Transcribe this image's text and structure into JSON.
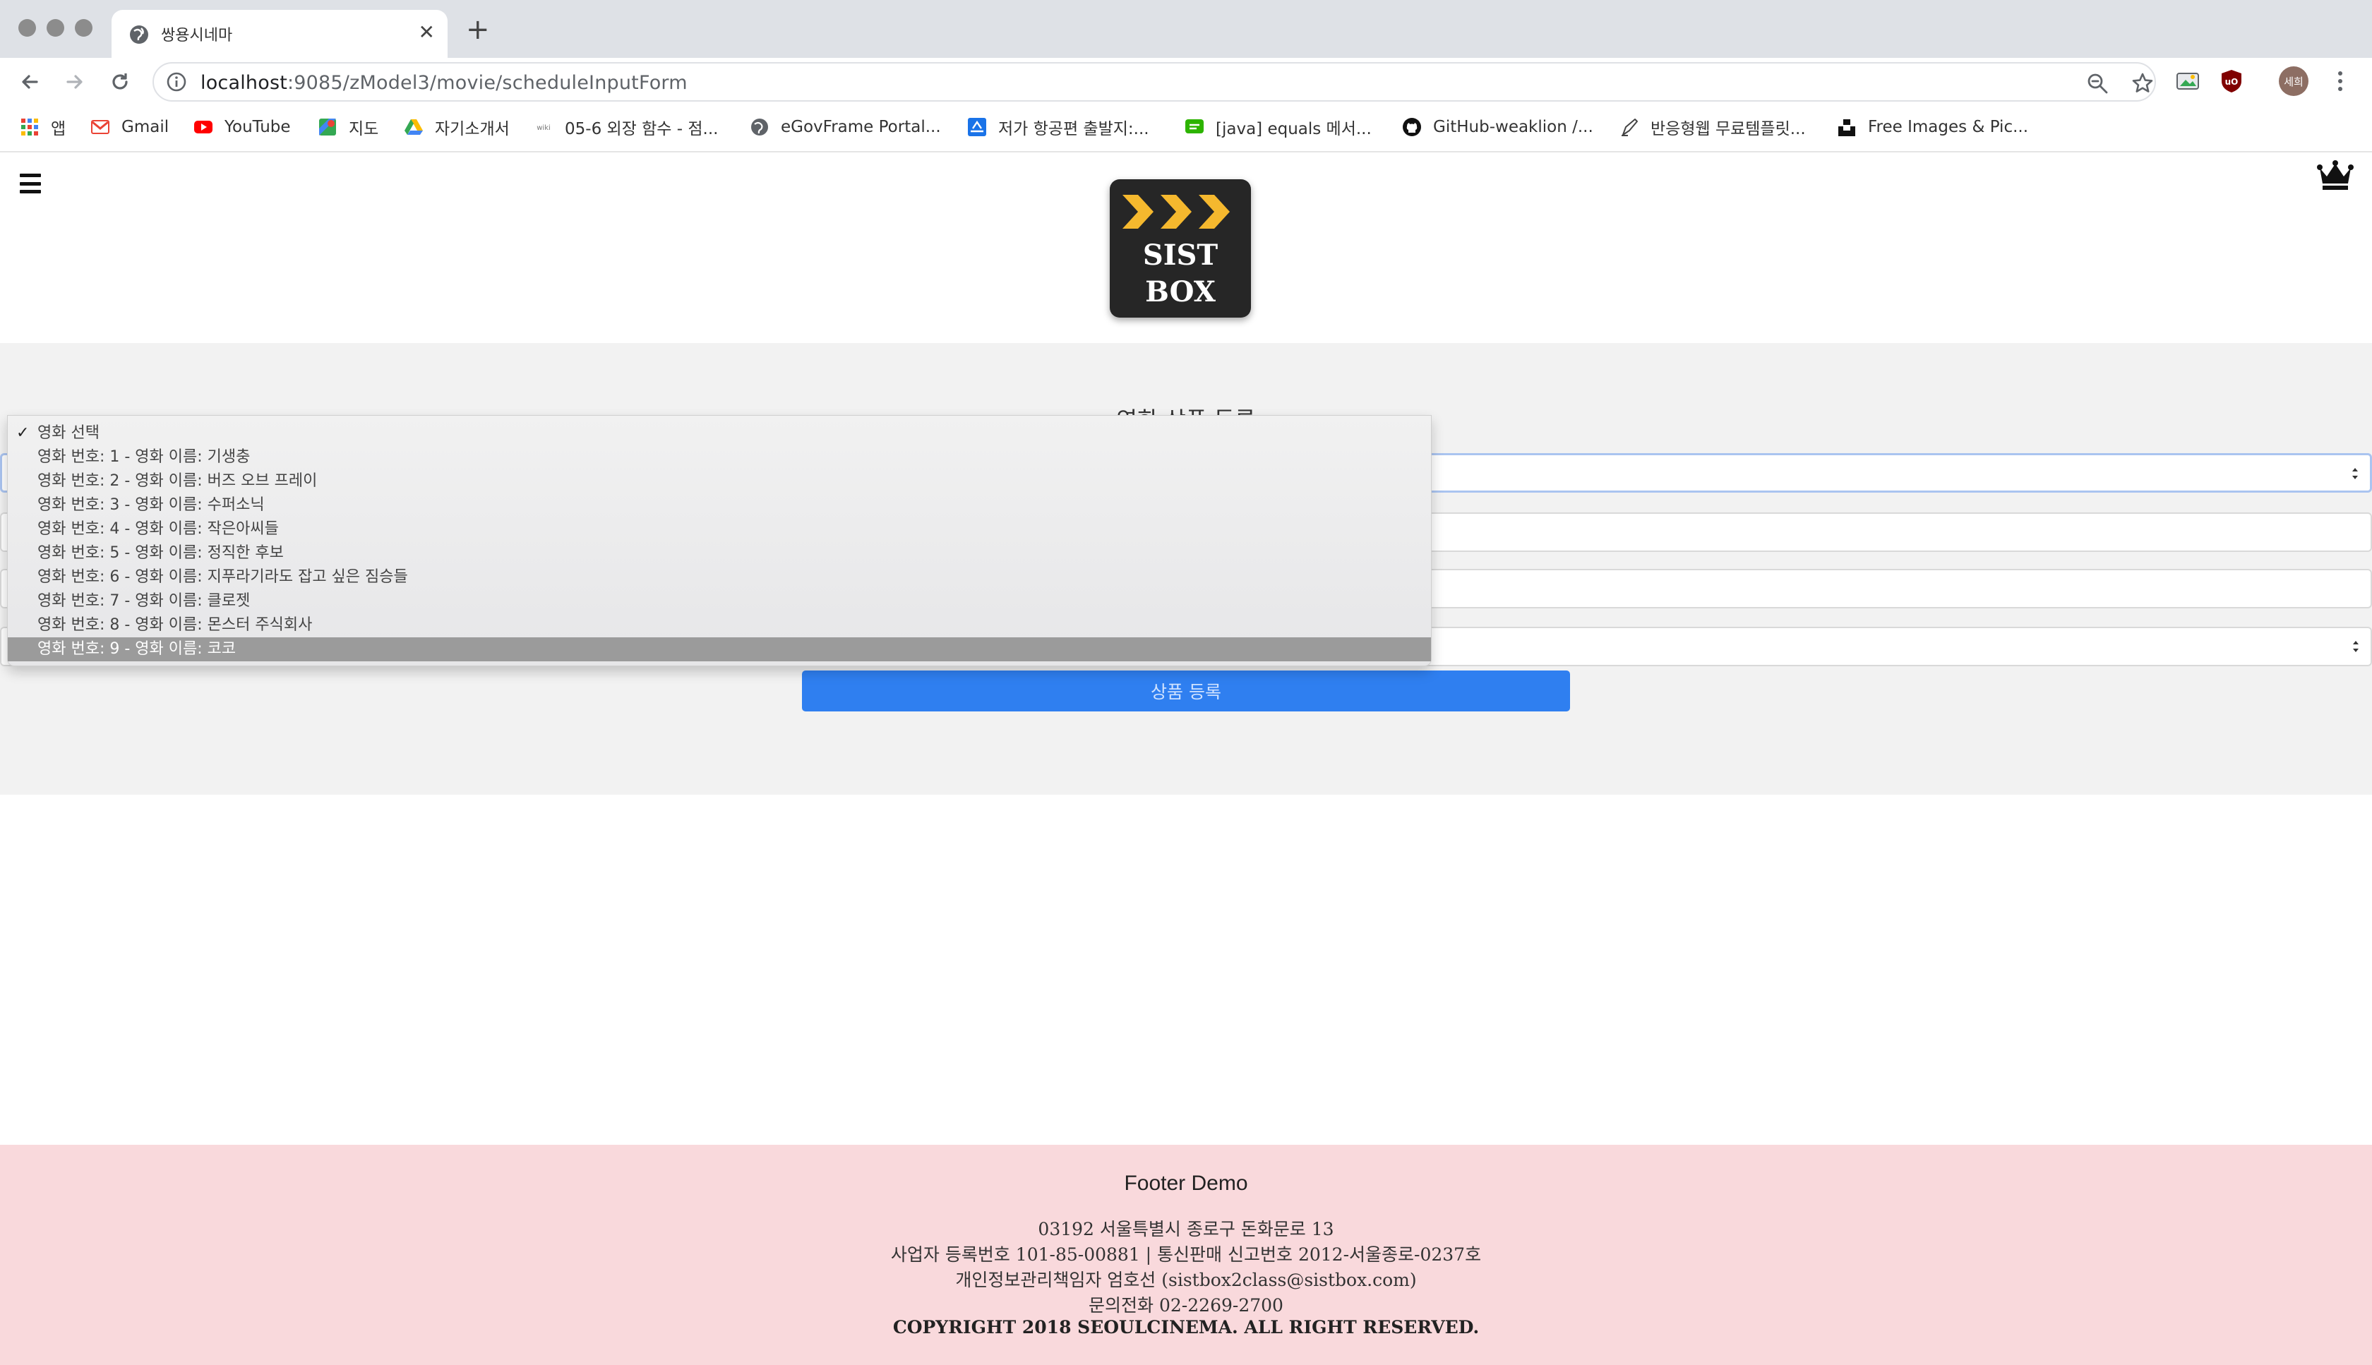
{
  "browser": {
    "tab_title": "쌍용시네마",
    "url_host": "localhost",
    "url_path": ":9085/zModel3/movie/scheduleInputForm",
    "avatar_text": "세희",
    "bookmarks": [
      {
        "label": "앱",
        "icon": "apps-grid-icon"
      },
      {
        "label": "Gmail",
        "icon": "gmail-icon"
      },
      {
        "label": "YouTube",
        "icon": "youtube-icon"
      },
      {
        "label": "지도",
        "icon": "maps-icon"
      },
      {
        "label": "자기소개서",
        "icon": "drive-icon"
      },
      {
        "label": "05-6 외장 함수 - 점...",
        "icon": "wikidocs-icon"
      },
      {
        "label": "eGovFrame Portal...",
        "icon": "globe-icon"
      },
      {
        "label": "저가 항공편 출발지:...",
        "icon": "flight-icon"
      },
      {
        "label": "[java] equals 메서...",
        "icon": "chat-icon"
      },
      {
        "label": "GitHub-weaklion /...",
        "icon": "github-icon"
      },
      {
        "label": "반응형웹 무료템플릿...",
        "icon": "pen-icon"
      },
      {
        "label": "Free Images & Pic...",
        "icon": "unsplash-icon"
      }
    ]
  },
  "header": {
    "logo_line1": "SIST",
    "logo_line2": "BOX",
    "menu_icon": "hamburger-icon",
    "crown_icon": "crown-icon"
  },
  "form": {
    "title": "영화 상품 등록",
    "submit_label": "상품 등록",
    "movie_select": {
      "options": [
        "영화 선택",
        "영화 번호: 1 - 영화 이름: 기생충",
        "영화 번호: 2 - 영화 이름: 버즈 오브 프레이",
        "영화 번호: 3 - 영화 이름: 수퍼소닉",
        "영화 번호: 4 - 영화 이름: 작은아씨들",
        "영화 번호: 5 - 영화 이름: 정직한 후보",
        "영화 번호: 6 - 영화 이름: 지푸라기라도 잡고 싶은 짐승들",
        "영화 번호: 7 - 영화 이름: 클로젯",
        "영화 번호: 8 - 영화 이름: 몬스터 주식회사",
        "영화 번호: 9 - 영화 이름: 코코"
      ],
      "checked_index": 0,
      "highlighted_index": 9
    }
  },
  "footer": {
    "title": "Footer Demo",
    "address": "03192 서울특별시 종로구 돈화문로 13",
    "business": "사업자 등록번호 101-85-00881 | 통신판매 신고번호 2012-서울종로-0237호",
    "privacy": "개인정보관리책임자 엄호선 (sistbox2class@sistbox.com)",
    "phone": "문의전화 02-2269-2700",
    "copyright": "COPYRIGHT 2018 SEOULCINEMA. ALL RIGHT RESERVED."
  },
  "colors": {
    "accent_button": "#2f7ff0",
    "footer_bg": "#f9d9dc",
    "section_bg": "#f2f2f2",
    "logo_chevron": "#f5b82e"
  }
}
